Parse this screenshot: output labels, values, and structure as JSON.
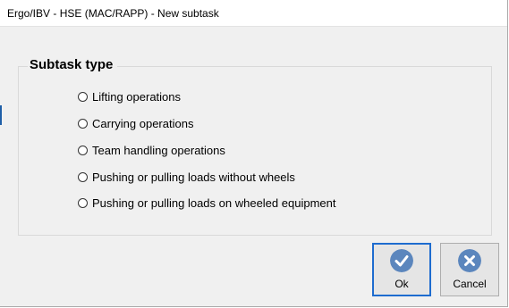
{
  "window": {
    "title": "Ergo/IBV - HSE (MAC/RAPP) - New subtask"
  },
  "subtask_type": {
    "title": "Subtask type",
    "options": [
      {
        "label": "Lifting operations",
        "selected": false
      },
      {
        "label": "Carrying operations",
        "selected": false
      },
      {
        "label": "Team handling operations",
        "selected": false
      },
      {
        "label": "Pushing or pulling loads without wheels",
        "selected": false
      },
      {
        "label": "Pushing or pulling loads on wheeled equipment",
        "selected": false
      }
    ]
  },
  "buttons": {
    "ok": {
      "label": "Ok",
      "icon": "check-circle-icon"
    },
    "cancel": {
      "label": "Cancel",
      "icon": "x-circle-icon"
    }
  },
  "colors": {
    "icon_blue": "#5b86bd",
    "default_button_border": "#1e6ccf"
  }
}
